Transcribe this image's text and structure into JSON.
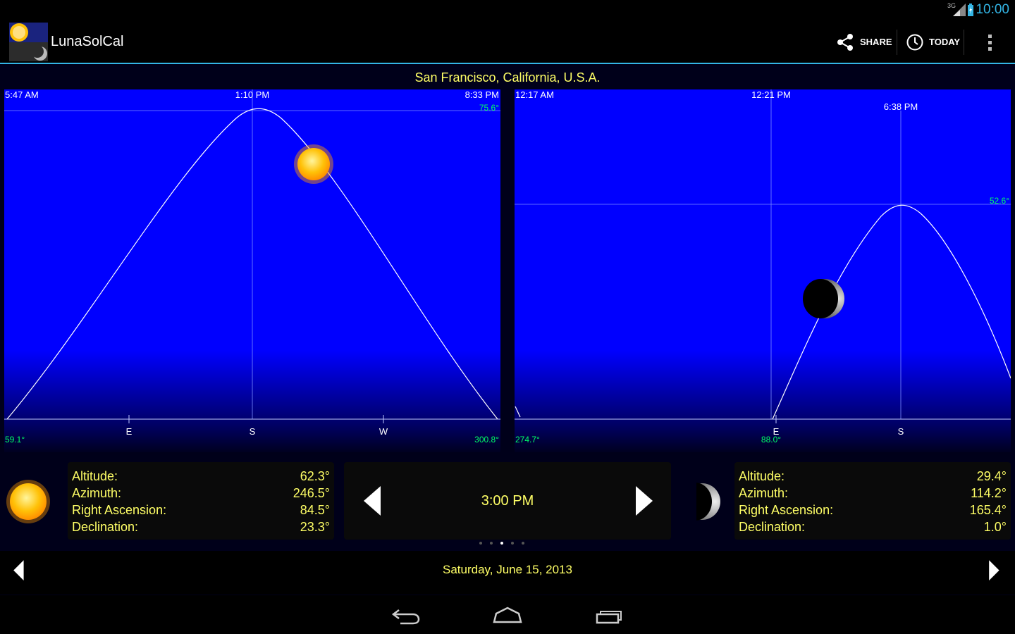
{
  "status_bar": {
    "network": "3G",
    "time": "10:00"
  },
  "app": {
    "title": "LunaSolCal"
  },
  "action_bar": {
    "share_label": "SHARE",
    "today_label": "TODAY"
  },
  "location": "San Francisco, California, U.S.A.",
  "sun_chart": {
    "rise_time": "5:47 AM",
    "transit_time": "1:10 PM",
    "set_time": "8:33 PM",
    "max_altitude_label": "75.6°",
    "rise_azimuth_label": "59.1°",
    "set_azimuth_label": "300.8°",
    "direction_labels": [
      "E",
      "S",
      "W"
    ]
  },
  "moon_chart": {
    "rise_time": "12:17 AM",
    "transit_time": "12:21 PM",
    "set_time": "6:38 PM",
    "max_altitude_label": "52.6°",
    "left_azimuth_label": "274.7°",
    "rise_azimuth_label": "88.0°",
    "direction_labels": [
      "E",
      "S"
    ]
  },
  "sun_info": {
    "rows": [
      {
        "label": "Altitude:",
        "value": "62.3°"
      },
      {
        "label": "Azimuth:",
        "value": "246.5°"
      },
      {
        "label": "Right Ascension:",
        "value": "84.5°"
      },
      {
        "label": "Declination:",
        "value": "23.3°"
      }
    ]
  },
  "moon_info": {
    "rows": [
      {
        "label": "Altitude:",
        "value": "29.4°"
      },
      {
        "label": "Azimuth:",
        "value": "114.2°"
      },
      {
        "label": "Right Ascension:",
        "value": "165.4°"
      },
      {
        "label": "Declination:",
        "value": "1.0°"
      }
    ]
  },
  "time_selector": {
    "time": "3:00 PM"
  },
  "pager": {
    "count": 5,
    "active_index": 2
  },
  "date_selector": {
    "date": "Saturday, June 15, 2013"
  },
  "colors": {
    "accent": "#33b5e5",
    "text_yellow": "#ffff66",
    "plot_blue": "#0000ff",
    "label_green": "#00ff66"
  },
  "icons": [
    "signal-icon",
    "battery-icon",
    "share-icon",
    "clock-icon",
    "overflow-menu-icon",
    "sun-icon",
    "moon-icon",
    "back-icon",
    "home-icon",
    "recents-icon"
  ]
}
